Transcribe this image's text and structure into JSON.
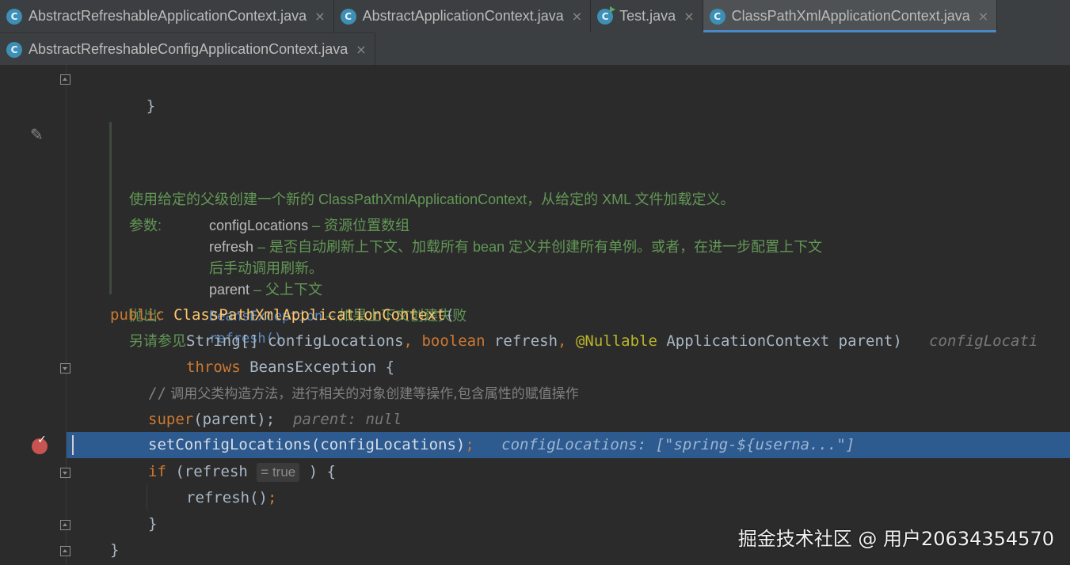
{
  "tabs_row1": [
    {
      "label": "AbstractRefreshableApplicationContext.java",
      "icon": "class-icon",
      "active": false,
      "close": "×"
    },
    {
      "label": "AbstractApplicationContext.java",
      "icon": "class-icon",
      "active": false,
      "close": "×"
    },
    {
      "label": "Test.java",
      "icon": "runnable-class-icon",
      "active": false,
      "close": "×"
    },
    {
      "label": "ClassPathXmlApplicationContext.java",
      "icon": "class-icon",
      "active": true,
      "close": "×"
    }
  ],
  "tabs_row2": [
    {
      "label": "AbstractRefreshableConfigApplicationContext.java",
      "icon": "class-icon",
      "active": false,
      "close": "×"
    }
  ],
  "class_icon_letter": "C",
  "code": {
    "line_close_brace": "}",
    "doc": {
      "summary": "使用给定的父级创建一个新的 ClassPathXmlApplicationContext，从给定的 XML 文件加载定义。",
      "params_label": "参数:",
      "param1_name": "configLocations",
      "param1_desc": " – 资源位置数组",
      "param2_name": "refresh",
      "param2_desc": " – 是否自动刷新上下文、加载所有 bean 定义并创建所有单例。或者，在进一步配置上下文",
      "param2_desc_cont": "后手动调用刷新。",
      "param3_name": "parent",
      "param3_desc": " – 父上下文",
      "throws_label": "抛出:",
      "throws_name": "BeansException",
      "throws_desc": " – 如果上下文创建失败",
      "see_label": "另请参见:",
      "see_link": "refresh()"
    },
    "l1_public": "public",
    "l1_name": "ClassPathXmlApplicationContext",
    "l1_paren": "(",
    "l2_string": "String[] configLocations",
    "l2_comma1": ",",
    "l2_boolean": "boolean",
    "l2_refresh": " refresh",
    "l2_comma2": ",",
    "l2_nullable": "@Nullable",
    "l2_parent": " ApplicationContext parent)",
    "l2_hint": "configLocati",
    "l3_throws": "throws",
    "l3_rest": " BeansException {",
    "l4_slashes": "//",
    "l4_comment": " 调用父类构造方法，进行相关的对象创建等操作,包含属性的赋值操作",
    "l5_super": "super",
    "l5_rest": "(parent);",
    "l5_hint": "parent: null",
    "l6_code": "setConfigLocations(configLocations)",
    "l6_semi": ";",
    "l6_hint": "configLocations: [\"spring-${userna...\"]",
    "l7_if": "if",
    "l7_open": " (refresh",
    "l7_hint": "= true",
    "l7_close": ") {",
    "l8_code": "refresh()",
    "l8_semi": ";",
    "l9_brace": "}",
    "l10_brace": "}"
  },
  "watermark": "掘金技术社区 @ 用户20634354570",
  "colors": {
    "background": "#2b2b2b",
    "keyword": "#cc7832",
    "method": "#ffc66d",
    "doc": "#629755",
    "execution_line": "#2d5a8f",
    "breakpoint": "#c75450"
  }
}
